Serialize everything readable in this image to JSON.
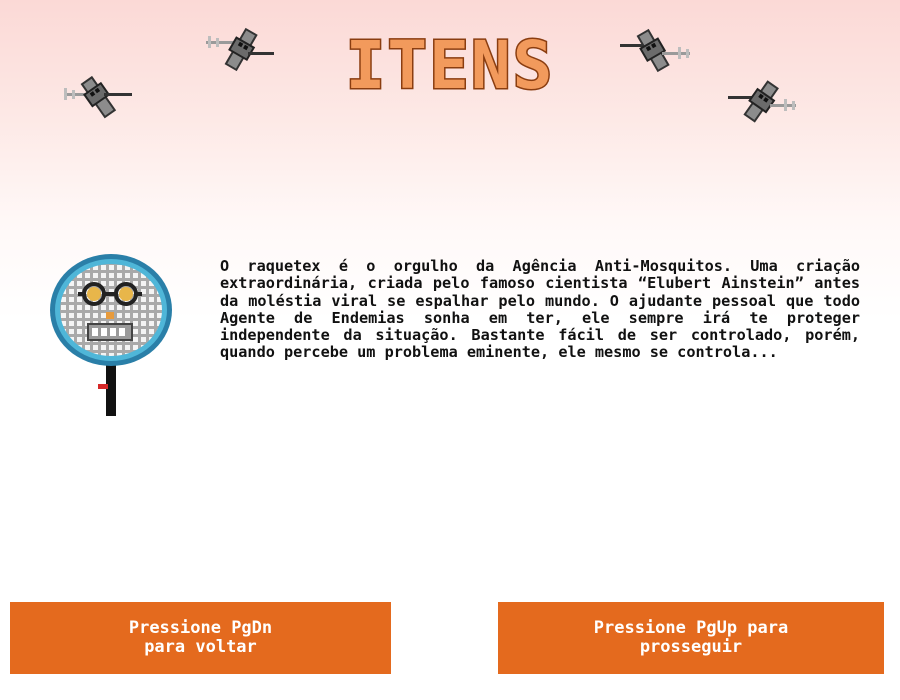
{
  "screen": {
    "title": "ITENS",
    "description": "O raquetex é o orgulho da Agência Anti-Mosquitos. Uma criação extraordinária, criada pelo famoso cientista “Elubert Ainstein” antes da moléstia viral se espalhar pelo mundo. O ajudante pessoal que todo Agente de Endemias sonha em ter, ele sempre irá te proteger independente da situação. Bastante fácil de ser controlado, porém, quando percebe um problema eminente, ele mesmo se controla..."
  },
  "buttons": {
    "back_label": "Pressione PgDn\npara voltar",
    "next_label": "Pressione PgUp para\nprosseguir"
  },
  "icons": {
    "decorations": [
      "mosquito-icon",
      "mosquito-icon",
      "mosquito-icon",
      "mosquito-icon"
    ],
    "item": "racket-robot-icon"
  },
  "colors": {
    "title_fill": "#f29a5c",
    "title_outline": "#8a3d10",
    "button_bg": "#e46a1e",
    "button_text": "#ffffff",
    "racket_rim": "#3aa0c8",
    "racket_handle": "#111111",
    "mosquito_body": "#8c8c8c"
  }
}
